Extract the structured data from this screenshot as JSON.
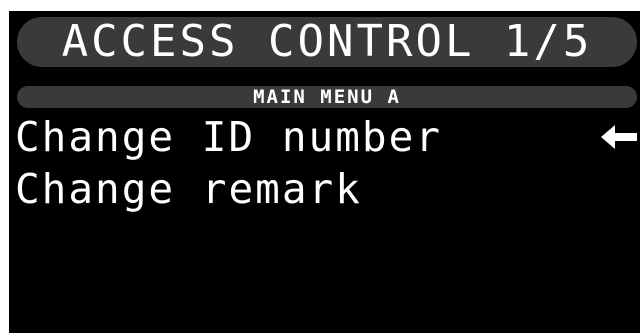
{
  "header": {
    "title": "ACCESS CONTROL 1/5",
    "subtitle": "MAIN MENU A"
  },
  "menu": {
    "items": [
      {
        "label": "Change ID number",
        "selected": true
      },
      {
        "label": "Change remark",
        "selected": false
      }
    ]
  },
  "icons": {
    "selection_indicator": "arrow-left-icon"
  },
  "colors": {
    "screen_background": "#000000",
    "text": "#ffffff",
    "bar_background": "#3a3a3a"
  }
}
